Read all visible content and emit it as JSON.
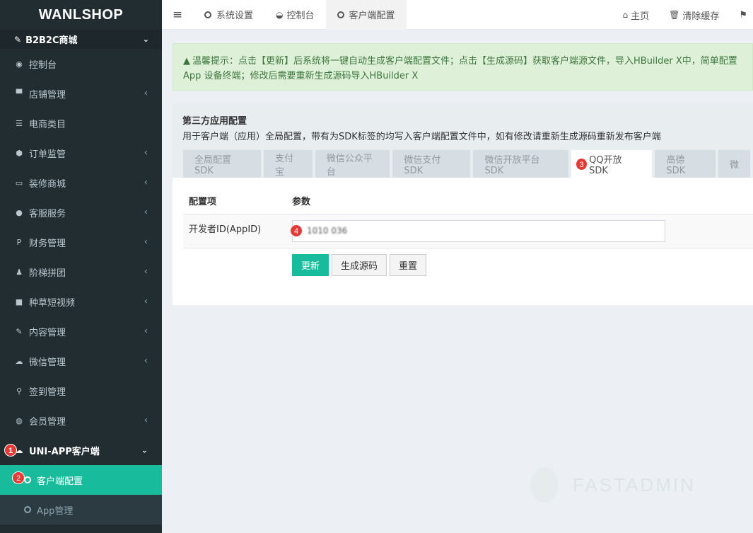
{
  "brand": "WANLSHOP",
  "sidebar": {
    "section_title": "B2B2C商城",
    "items": [
      {
        "label": "控制台",
        "icon": "dashboard-icon"
      },
      {
        "label": "店铺管理",
        "icon": "store-icon"
      },
      {
        "label": "电商类目",
        "icon": "list-icon"
      },
      {
        "label": "订单监管",
        "icon": "cube-icon"
      },
      {
        "label": "装修商城",
        "icon": "desktop-icon"
      },
      {
        "label": "客服服务",
        "icon": "comments-icon"
      },
      {
        "label": "财务管理",
        "icon": "paypal-icon"
      },
      {
        "label": "阶梯拼团",
        "icon": "users-icon"
      },
      {
        "label": "种草短视频",
        "icon": "video-icon"
      },
      {
        "label": "内容管理",
        "icon": "edit-icon"
      },
      {
        "label": "微信管理",
        "icon": "wechat-icon"
      },
      {
        "label": "签到管理",
        "icon": "map-marker-icon"
      },
      {
        "label": "会员管理",
        "icon": "user-circle-icon"
      }
    ],
    "open_group": "UNI-APP客户端",
    "sub_items": [
      {
        "label": "客户端配置",
        "active": true
      },
      {
        "label": "App管理",
        "active": false
      }
    ]
  },
  "topbar": {
    "tabs": [
      {
        "label": "系统设置"
      },
      {
        "label": "控制台"
      },
      {
        "label": "客户端配置"
      }
    ],
    "right": {
      "home": "主页",
      "clear_cache": "清除缓存"
    }
  },
  "alert": {
    "text": "温馨提示：点击【更新】后系统将一键自动生成客户端配置文件；点击【生成源码】获取客户端源文件，导入HBuilder X中，简单配置App 设备终端；修改后需要重新生成源码导入HBuilder X"
  },
  "panel": {
    "title": "第三方应用配置",
    "description": "用于客户端（应用）全局配置，带有为SDK标签的均写入客户端配置文件中，如有修改请重新生成源码重新发布客户端",
    "tabs": [
      "全局配置 SDK",
      "支付宝",
      "微信公众平台",
      "微信支付 SDK",
      "微信开放平台 SDK",
      "QQ开放 SDK",
      "高德 SDK",
      "微"
    ],
    "active_tab": 5,
    "table": {
      "headers": [
        "配置项",
        "参数"
      ],
      "rows": [
        {
          "label": "开发者ID(AppID)",
          "value": "1010  036"
        }
      ]
    },
    "buttons": {
      "update": "更新",
      "generate": "生成源码",
      "reset": "重置"
    }
  },
  "annotations": [
    "1",
    "2",
    "3",
    "4"
  ],
  "watermark": "FASTADMIN",
  "colors": {
    "accent": "#18bc9c",
    "sidebar": "#222d32",
    "alert_bg": "#dff0d8",
    "badge": "#e53935"
  }
}
